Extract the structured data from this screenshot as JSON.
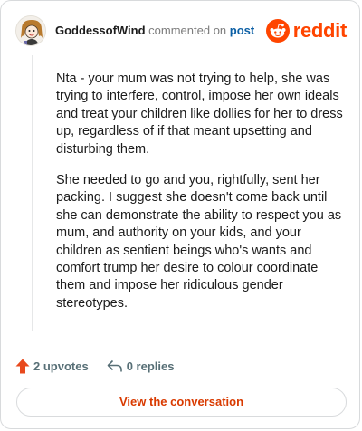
{
  "comment": {
    "author": "GoddessofWind",
    "action_text": "commented on",
    "post_link": "post",
    "paragraphs": [
      "Nta - your mum was not trying to help, she was trying to interfere, control, impose her own ideals and treat your children like dollies for her to dress up, regardless of if that meant upsetting and disturbing them.",
      "She needed to go and you, rightfully, sent her packing. I suggest she doesn't come back until she can demonstrate the ability to respect you as mum, and authority on your kids, and your children as sentient beings who's wants and comfort trump her desire to colour coordinate them and impose her ridiculous gender stereotypes."
    ]
  },
  "brand": {
    "name": "reddit",
    "color": "#ff4500",
    "icon": "reddit-snoo-icon"
  },
  "actions": {
    "upvotes": "2 upvotes",
    "upvote_icon": "upvote-arrow-icon",
    "upvote_color": "#e8491d",
    "replies": "0 replies",
    "reply_icon": "reply-arrow-icon"
  },
  "view_button": {
    "label": "View the conversation",
    "color": "#d93a00"
  }
}
